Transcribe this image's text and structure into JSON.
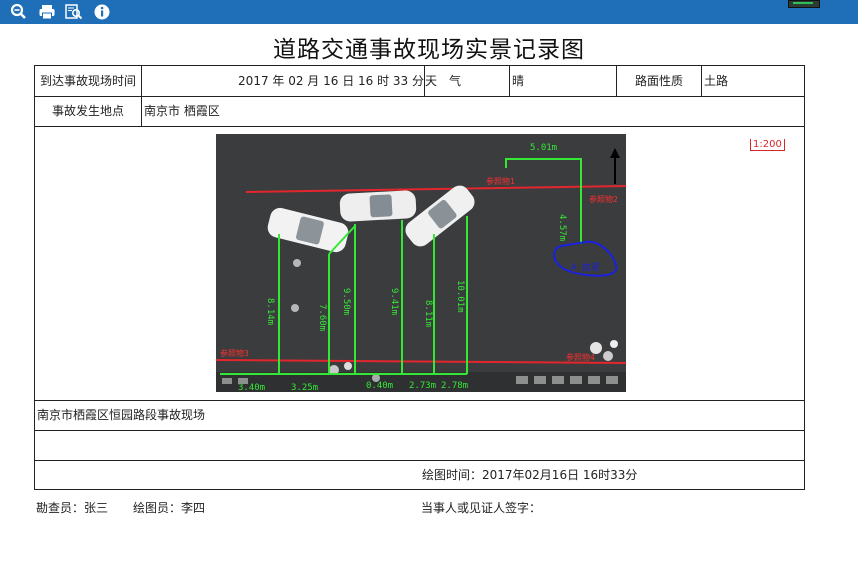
{
  "toolbar": {
    "icons": [
      "zoom-in-icon",
      "print-icon",
      "search-preview-icon",
      "info-icon"
    ]
  },
  "document": {
    "title": "道路交通事故现场实景记录图",
    "row1": {
      "arrival_label": "到达事故现场时间",
      "arrival_value": "2017 年 02 月 16 日 16 时 33 分",
      "weather_label": "天　气",
      "weather_value": "晴",
      "road_label": "路面性质",
      "road_value": "土路"
    },
    "row2": {
      "location_label": "事故发生地点",
      "location_value": "南京市 栖霞区"
    },
    "scale": "1:200",
    "photo": {
      "measurements": [
        "5.01m",
        "4.57m",
        "8.14m",
        "7.60m",
        "9.50m",
        "9.41m",
        "8.11m",
        "10.01m",
        "3.40m",
        "3.25m",
        "0.40m",
        "2.73m",
        "2.78m"
      ],
      "marker_label": "A 血迹",
      "red_labels": [
        "参照物1",
        "参照物2",
        "参照物3",
        "参照物4"
      ]
    },
    "caption": "南京市栖霞区恒园路段事故现场",
    "drawn_time": "绘图时间：2017年02月16日 16时33分"
  },
  "footer": {
    "inspector": "勘查员：张三",
    "drafter": "绘图员：李四",
    "signature": "当事人或见证人签字："
  }
}
